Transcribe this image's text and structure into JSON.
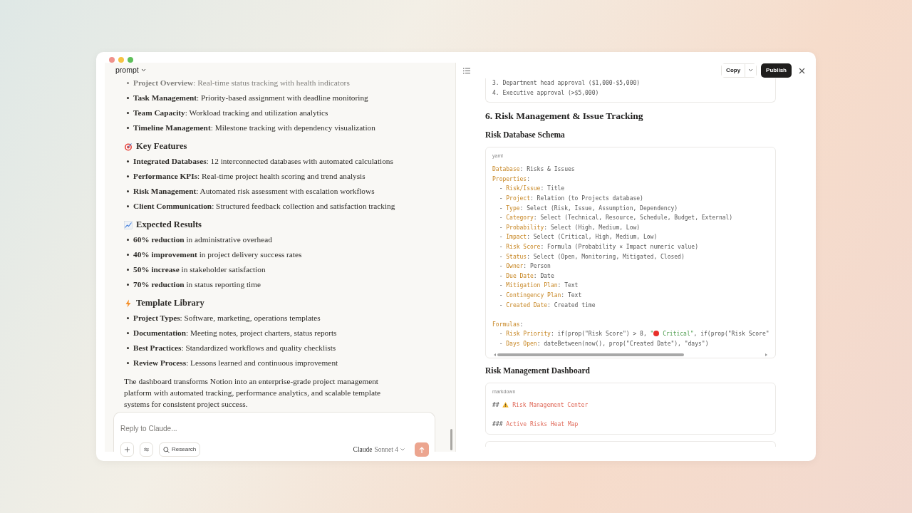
{
  "chat": {
    "title": "prompt",
    "blocks": [
      {
        "kind": "list",
        "faded_first": true,
        "items": [
          "**Project Overview**: Real-time status tracking with health indicators",
          "**Task Management**: Priority-based assignment with deadline monitoring",
          "**Team Capacity**: Workload tracking and utilization analytics",
          "**Timeline Management**: Milestone tracking with dependency visualization"
        ]
      },
      {
        "kind": "heading",
        "text": "Key Features"
      },
      {
        "kind": "list",
        "items": [
          "**Integrated Databases**: 12 interconnected databases with automated calculations",
          "**Performance KPIs**: Real-time project health scoring and trend analysis",
          "**Risk Management**: Automated risk assessment with escalation workflows",
          "**Client Communication**: Structured feedback collection and satisfaction tracking"
        ]
      },
      {
        "kind": "heading",
        "text": "Expected Results"
      },
      {
        "kind": "list",
        "items": [
          "**60% reduction** in administrative overhead",
          "**40% improvement** in project delivery success rates",
          "**50% increase** in stakeholder satisfaction",
          "**70% reduction** in status reporting time"
        ]
      },
      {
        "kind": "heading",
        "text": "Template Library"
      },
      {
        "kind": "list",
        "items": [
          "**Project Types**: Software, marketing, operations templates",
          "**Documentation**: Meeting notes, project charters, status reports",
          "**Best Practices**: Standardized workflows and quality checklists",
          "**Review Process**: Lessons learned and continuous improvement"
        ]
      },
      {
        "kind": "paragraph",
        "text": "The dashboard transforms Notion into an enterprise-grade project management platform with automated tracking, performance analytics, and scalable template systems for consistent project success."
      }
    ],
    "composer": {
      "placeholder": "Reply to Claude...",
      "research_label": "Research",
      "model_brand": "Claude",
      "model_name": "Sonnet 4"
    }
  },
  "artifact": {
    "copy_label": "Copy",
    "publish_label": "Publish",
    "blocks": [
      {
        "kind": "code",
        "cut_top": true,
        "lines": [
          [
            {
              "t": "3. Department head approval ($1,000-$5,000)"
            }
          ],
          [
            {
              "t": "4. Executive approval (>$5,000)"
            }
          ]
        ]
      },
      {
        "kind": "h2",
        "text": "6. Risk Management & Issue Tracking"
      },
      {
        "kind": "h3",
        "text": "Risk Database Schema"
      },
      {
        "kind": "code",
        "language": "yaml",
        "scrollbar": true,
        "lines": [
          [
            {
              "kind": "key",
              "t": "Database"
            },
            {
              "t": ": Risks & Issues"
            }
          ],
          [
            {
              "kind": "key",
              "t": "Properties"
            },
            {
              "t": ":"
            }
          ],
          [
            {
              "t": "  - "
            },
            {
              "kind": "key",
              "t": "Risk/Issue"
            },
            {
              "t": ": Title"
            }
          ],
          [
            {
              "t": "  - "
            },
            {
              "kind": "key",
              "t": "Project"
            },
            {
              "t": ": Relation (to Projects database)"
            }
          ],
          [
            {
              "t": "  - "
            },
            {
              "kind": "key",
              "t": "Type"
            },
            {
              "t": ": Select (Risk, Issue, Assumption, Dependency)"
            }
          ],
          [
            {
              "t": "  - "
            },
            {
              "kind": "key",
              "t": "Category"
            },
            {
              "t": ": Select (Technical, Resource, Schedule, Budget, External)"
            }
          ],
          [
            {
              "t": "  - "
            },
            {
              "kind": "key",
              "t": "Probability"
            },
            {
              "t": ": Select (High, Medium, Low)"
            }
          ],
          [
            {
              "t": "  - "
            },
            {
              "kind": "key",
              "t": "Impact"
            },
            {
              "t": ": Select (Critical, High, Medium, Low)"
            }
          ],
          [
            {
              "t": "  - "
            },
            {
              "kind": "key",
              "t": "Risk Score"
            },
            {
              "t": ": Formula (Probability × Impact numeric value)"
            }
          ],
          [
            {
              "t": "  - "
            },
            {
              "kind": "key",
              "t": "Status"
            },
            {
              "t": ": Select (Open, Monitoring, Mitigated, Closed)"
            }
          ],
          [
            {
              "t": "  - "
            },
            {
              "kind": "key",
              "t": "Owner"
            },
            {
              "t": ": Person"
            }
          ],
          [
            {
              "t": "  - "
            },
            {
              "kind": "key",
              "t": "Due Date"
            },
            {
              "t": ": Date"
            }
          ],
          [
            {
              "t": "  - "
            },
            {
              "kind": "key",
              "t": "Mitigation Plan"
            },
            {
              "t": ": Text"
            }
          ],
          [
            {
              "t": "  - "
            },
            {
              "kind": "key",
              "t": "Contingency Plan"
            },
            {
              "t": ": Text"
            }
          ],
          [
            {
              "t": "  - "
            },
            {
              "kind": "key",
              "t": "Created Date"
            },
            {
              "t": ": Created time"
            }
          ],
          [
            {
              "kind": "blank"
            }
          ],
          [
            {
              "kind": "key",
              "t": "Formulas"
            },
            {
              "t": ":"
            }
          ],
          [
            {
              "t": "  - "
            },
            {
              "kind": "key",
              "t": "Risk Priority"
            },
            {
              "t": ": if(prop(\"Risk Score\") > 8, "
            },
            {
              "kind": "string",
              "t": "\""
            },
            {
              "kind": "dot"
            },
            {
              "kind": "string",
              "t": " Critical\""
            },
            {
              "t": ", if(prop(\"Risk Score\""
            }
          ],
          [
            {
              "t": "  - "
            },
            {
              "kind": "key",
              "t": "Days Open"
            },
            {
              "t": ": dateBetween(now(), prop(\"Created Date\"), \"days\")"
            }
          ]
        ]
      },
      {
        "kind": "h3",
        "text": "Risk Management Dashboard"
      },
      {
        "kind": "code",
        "language": "markdown",
        "lines": [
          [
            {
              "t": "## "
            },
            {
              "kind": "warning"
            },
            {
              "kind": "heading",
              "t": " Risk Management Center"
            }
          ],
          [
            {
              "kind": "blank"
            }
          ],
          [
            {
              "t": "### "
            },
            {
              "kind": "heading",
              "t": "Active Risks Heat Map"
            }
          ]
        ]
      },
      {
        "kind": "code",
        "cut_bottom": true
      }
    ]
  }
}
